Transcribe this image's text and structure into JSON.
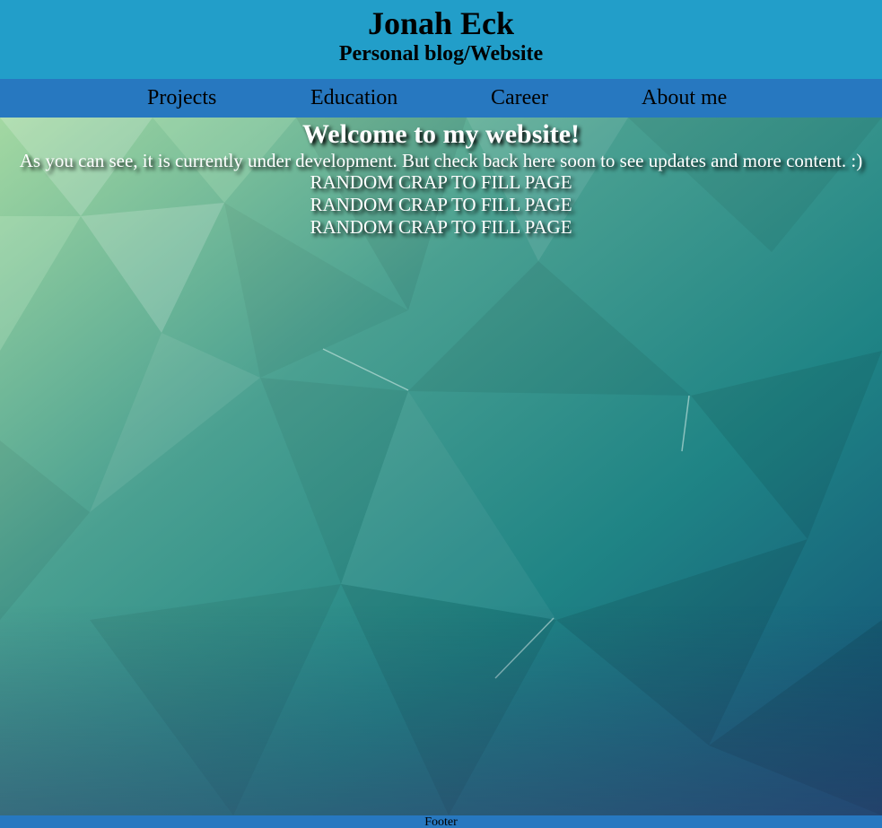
{
  "header": {
    "title": "Jonah Eck",
    "subtitle": "Personal blog/Website"
  },
  "nav": {
    "items": [
      "Projects",
      "Education",
      "Career",
      "About me"
    ]
  },
  "main": {
    "welcome": "Welcome to my website!",
    "intro": "As you can see, it is currently under development. But check back here soon to see updates and more content. :)",
    "filler": [
      "RANDOM CRAP TO FILL PAGE",
      "RANDOM CRAP TO FILL PAGE",
      "RANDOM CRAP TO FILL PAGE"
    ]
  },
  "footer": {
    "text": "Footer"
  },
  "colors": {
    "header_bg": "#229ec9",
    "nav_bg": "#2778c0",
    "background_light": "#9fd6a0",
    "background_dark": "#0d4f6e"
  }
}
